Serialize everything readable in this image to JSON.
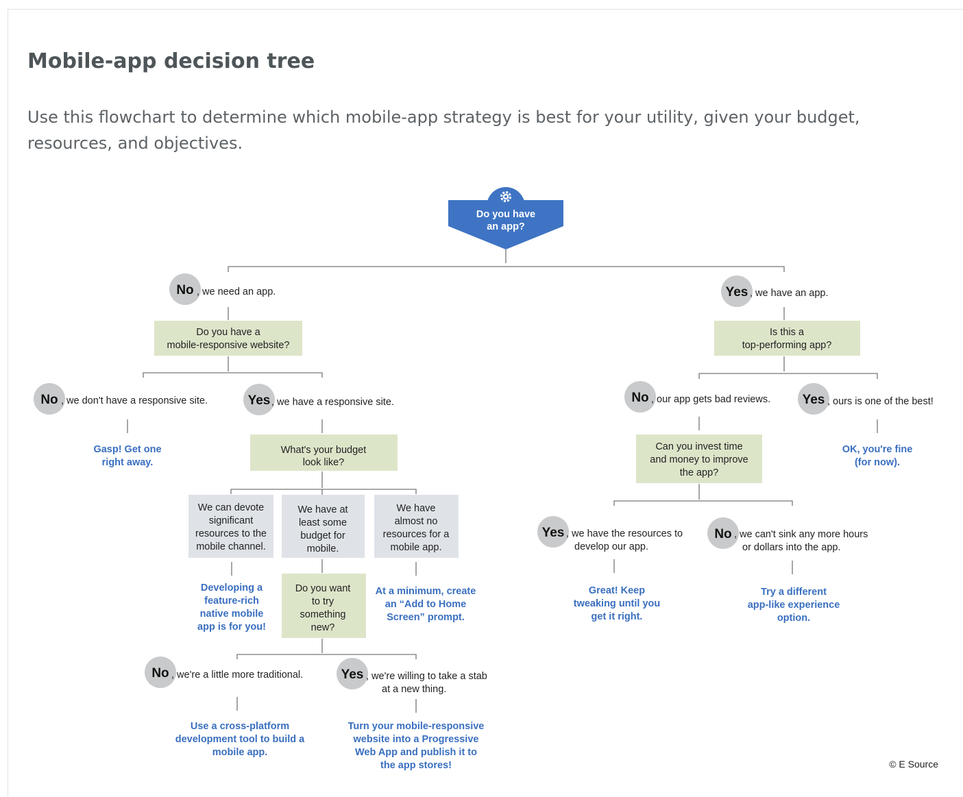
{
  "page": {
    "title": "Mobile-app decision tree",
    "intro": "Use this flowchart to determine which mobile-app strategy is best for your utility, given your budget, resources, and objectives."
  },
  "tree": {
    "start": [
      "Do you have",
      "an app?"
    ],
    "yes_word": "Yes",
    "no_word": "No",
    "no_app": ", we need an app.",
    "q_responsive": [
      "Do you have a",
      "mobile-responsive website?"
    ],
    "no_responsive": ", we don't have a responsive site.",
    "res_gasp": [
      "Gasp! Get one",
      "right away."
    ],
    "yes_responsive": ", we have a responsive site.",
    "q_budget": [
      "What's your budget",
      "look like?"
    ],
    "budget_significant": [
      "We can devote",
      "significant",
      "resources to the",
      "mobile channel."
    ],
    "budget_some": [
      "We have at",
      "least some",
      "budget for",
      "mobile."
    ],
    "budget_none": [
      "We have",
      "almost no",
      "resources for a",
      "mobile app."
    ],
    "res_native": [
      "Developing a",
      "feature-rich",
      "native mobile",
      "app is for you!"
    ],
    "q_new": [
      "Do you want",
      "to try",
      "something",
      "new?"
    ],
    "res_prompt": [
      "At a minimum, create",
      "an “Add to Home",
      "Screen” prompt."
    ],
    "no_traditional": ", we're a little more traditional.",
    "yes_new": [
      ", we're willing to take a stab",
      "at a new thing."
    ],
    "res_cross": [
      "Use a cross-platform",
      "development tool to build a",
      "mobile app."
    ],
    "res_pwa": [
      "Turn your mobile-responsive",
      "website into a Progressive",
      "Web App and publish it to",
      "the app stores!"
    ],
    "yes_app": ", we have an app.",
    "q_top": [
      "Is this a",
      "top-performing app?"
    ],
    "no_top": ", our app gets bad reviews.",
    "yes_top": ", ours is one of the best!",
    "res_fine": [
      "OK, you're fine",
      "(for now)."
    ],
    "q_invest": [
      "Can you invest time",
      "and money to improve",
      "the app?"
    ],
    "yes_invest": [
      ", we have the resources to",
      "develop our app."
    ],
    "no_invest": [
      ", we can't sink any more hours",
      "or dollars into the app."
    ],
    "res_keep": [
      "Great! Keep",
      "tweaking until you",
      "get it right."
    ],
    "res_different": [
      "Try a different",
      "app-like experience",
      "option."
    ],
    "credit": "© E Source"
  },
  "colors": {
    "start_box": "#3f74c4",
    "question_box": "#dde5c9",
    "budget_box": "#dfe3e8",
    "answer_circle": "#c9cacb",
    "result_text": "#3a6fbf"
  },
  "icons": [
    "gear-icon"
  ]
}
